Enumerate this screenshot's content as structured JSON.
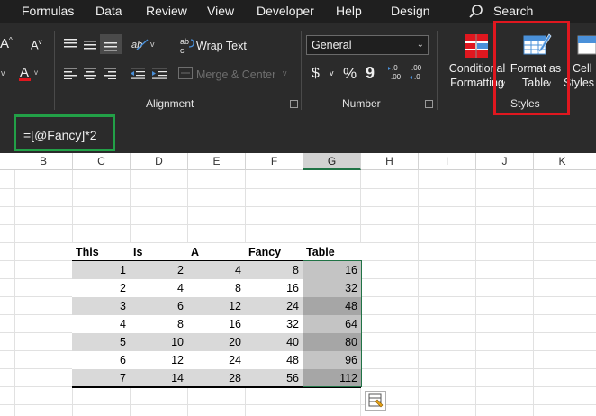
{
  "tabs": [
    "Formulas",
    "Data",
    "Review",
    "View",
    "Developer",
    "Help",
    "Design"
  ],
  "search": {
    "label": "Search"
  },
  "ribbon": {
    "alignment": {
      "label": "Alignment",
      "wrap_text": "Wrap Text",
      "merge_center": "Merge & Center"
    },
    "number": {
      "label": "Number",
      "format_value": "General",
      "currency": "$",
      "percent": "%",
      "comma": "9",
      "inc_decimal": ".00",
      "dec_decimal": ".00"
    },
    "styles": {
      "label": "Styles",
      "conditional_formatting": [
        "Conditional",
        "Formatting"
      ],
      "format_as_table": [
        "Format as",
        "Table"
      ],
      "cell_styles": [
        "Cell",
        "Styles"
      ]
    }
  },
  "formula_bar": {
    "formula": "=[@Fancy]*2"
  },
  "columns": [
    "B",
    "C",
    "D",
    "E",
    "F",
    "G",
    "H",
    "I",
    "J",
    "K"
  ],
  "selected_column": "G",
  "table": {
    "headers": [
      "This",
      "Is",
      "A",
      "Fancy",
      "Table"
    ],
    "rows": [
      [
        "1",
        "2",
        "4",
        "8",
        "16"
      ],
      [
        "2",
        "4",
        "8",
        "16",
        "32"
      ],
      [
        "3",
        "6",
        "12",
        "24",
        "48"
      ],
      [
        "4",
        "8",
        "16",
        "32",
        "64"
      ],
      [
        "5",
        "10",
        "20",
        "40",
        "80"
      ],
      [
        "6",
        "12",
        "24",
        "48",
        "96"
      ],
      [
        "7",
        "14",
        "28",
        "56",
        "112"
      ]
    ]
  },
  "colors": {
    "highlight_red": "#e0171f",
    "highlight_green": "#22a047",
    "table_band": "#d9d9d9",
    "selection_band": "#c4c4c4",
    "selection_band_dark": "#a6a6a6",
    "excel_green": "#217346"
  },
  "icons": [
    "search-icon",
    "font-increase-icon",
    "font-decrease-icon",
    "font-color-icon",
    "align-top-icon",
    "align-middle-icon",
    "align-bottom-icon",
    "orientation-icon",
    "wrap-text-icon",
    "merge-center-icon",
    "align-left-icon",
    "align-center-icon",
    "align-right-icon",
    "indent-decrease-icon",
    "indent-increase-icon",
    "currency-icon",
    "percent-icon",
    "comma-icon",
    "increase-decimal-icon",
    "decrease-decimal-icon",
    "conditional-formatting-icon",
    "format-as-table-icon",
    "cell-styles-icon",
    "quick-analysis-icon"
  ]
}
